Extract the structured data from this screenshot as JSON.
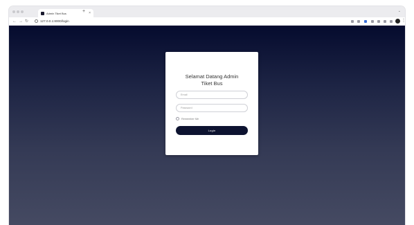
{
  "browser": {
    "tab_title": "Admin Tiket Bus",
    "tab_close": "×",
    "new_tab": "+",
    "url": "127.0.0.1:8000/login"
  },
  "page": {
    "title_line1": "Selamat Datang Admin",
    "title_line2": "Tiket Bus",
    "email_placeholder": "Email",
    "password_placeholder": "Password",
    "remember_label": "Remember Me",
    "login_label": "Login"
  },
  "colors": {
    "background_top": "#050b2e",
    "background_bottom": "#454a62",
    "button": "#0d1330",
    "card": "#ffffff"
  }
}
